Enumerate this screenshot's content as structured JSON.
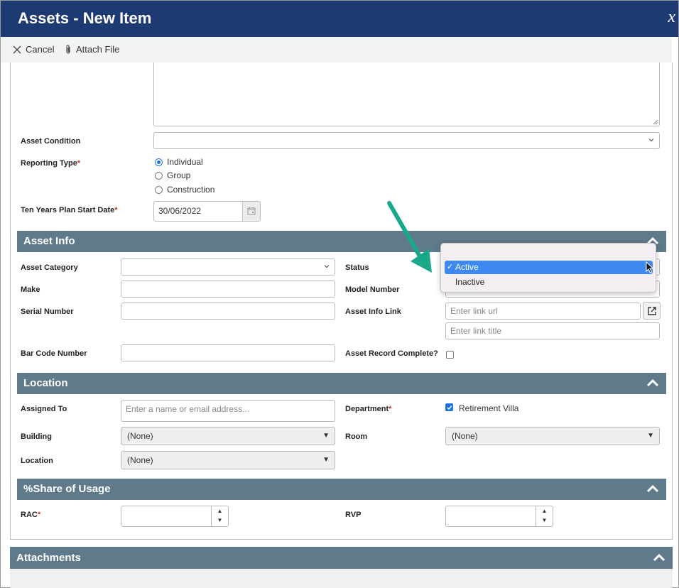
{
  "window": {
    "title": "Assets - New Item",
    "close_glyph": "x"
  },
  "toolbar": {
    "cancel_label": "Cancel",
    "attach_label": "Attach File"
  },
  "fields": {
    "asset_condition": "Asset Condition",
    "reporting_type": "Reporting Type",
    "reporting_options": [
      "Individual",
      "Group",
      "Construction"
    ],
    "reporting_selected": "Individual",
    "ten_years_label": "Ten Years Plan Start Date",
    "ten_years_value": "30/06/2022",
    "required_mark": "*"
  },
  "asset_info": {
    "title": "Asset Info",
    "category_label": "Asset Category",
    "status_label": "Status",
    "make_label": "Make",
    "model_label": "Model Number",
    "serial_label": "Serial Number",
    "link_label": "Asset Info Link",
    "link_url_placeholder": "Enter link url",
    "link_title_placeholder": "Enter link title",
    "barcode_label": "Bar Code Number",
    "record_complete_label": "Asset Record Complete?"
  },
  "status_dropdown": {
    "options": [
      "Active",
      "Inactive"
    ],
    "selected": "Active",
    "check_glyph": "✓"
  },
  "location": {
    "title": "Location",
    "assigned_label": "Assigned To",
    "assigned_placeholder": "Enter a name or email address...",
    "department_label": "Department",
    "department_value": "Retirement Villa",
    "building_label": "Building",
    "building_value": "(None)",
    "room_label": "Room",
    "room_value": "(None)",
    "location_label": "Location",
    "location_value": "(None)"
  },
  "share": {
    "title": "%Share of Usage",
    "rac_label": "RAC",
    "rvp_label": "RVP"
  },
  "attachments": {
    "title": "Attachments"
  },
  "colors": {
    "titlebar": "#1e3a73",
    "section": "#5f7b8b",
    "accent": "#1a73e8",
    "arrow": "#1aa88a",
    "required": "#c0392b"
  }
}
